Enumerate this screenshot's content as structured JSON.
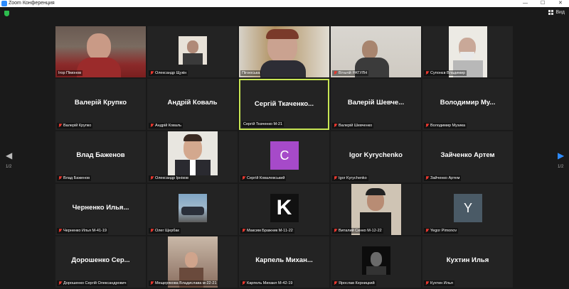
{
  "window": {
    "title": "Zoom Конференция",
    "view_label": "Вид",
    "minimize": "—",
    "maximize": "☐",
    "close": "✕"
  },
  "nav": {
    "left_page": "1/2",
    "right_page": "1/2"
  },
  "tiles": [
    {
      "label": "Ігор Пімонов",
      "display": "",
      "muted": false,
      "kind": "video-man"
    },
    {
      "label": "Олександр Щукін",
      "display": "",
      "muted": true,
      "kind": "photo"
    },
    {
      "label": "Пігоюська",
      "display": "",
      "muted": false,
      "kind": "video-woman"
    },
    {
      "label": "Віталій РАТУЛН",
      "display": "",
      "muted": true,
      "kind": "video-room"
    },
    {
      "label": "Супонєв Владимир",
      "display": "",
      "muted": true,
      "kind": "video-old"
    },
    {
      "label": "Валерій Крупко",
      "display": "Валерій Крупко",
      "muted": true,
      "kind": "name"
    },
    {
      "label": "Андрій Коваль",
      "display": "Андрій Коваль",
      "muted": true,
      "kind": "name"
    },
    {
      "label": "Сергій Ткаченко М-21",
      "display": "Сергій Ткаченко...",
      "muted": false,
      "kind": "name",
      "active": true
    },
    {
      "label": "Валерій Шевченко",
      "display": "Валерій Шевче...",
      "muted": true,
      "kind": "name"
    },
    {
      "label": "Володимир Музика",
      "display": "Володимир Му...",
      "muted": true,
      "kind": "name"
    },
    {
      "label": "Влад Баженов",
      "display": "Влад Баженов",
      "muted": true,
      "kind": "name"
    },
    {
      "label": "Олександр Ірніков",
      "display": "",
      "muted": true,
      "kind": "photo-portrait"
    },
    {
      "label": "Сергій Ковалевський",
      "display": "",
      "muted": true,
      "kind": "avatar-c",
      "avatar": "C"
    },
    {
      "label": "Igor Kyrychenko",
      "display": "Igor Kyrychenko",
      "muted": true,
      "kind": "name"
    },
    {
      "label": "Зайченко Артем",
      "display": "Зайченко Артем",
      "muted": true,
      "kind": "name"
    },
    {
      "label": "Черненко Илья М-41-19",
      "display": "Черненко Илья...",
      "muted": true,
      "kind": "name"
    },
    {
      "label": "Олег Щербак",
      "display": "",
      "muted": true,
      "kind": "photo-car"
    },
    {
      "label": "Максим Бражник М-11-22",
      "display": "",
      "muted": true,
      "kind": "logo-k"
    },
    {
      "label": "Виталий Сенко М-12-22",
      "display": "",
      "muted": true,
      "kind": "photo-selfie"
    },
    {
      "label": "Yegor Pimonov",
      "display": "",
      "muted": true,
      "kind": "avatar-y",
      "avatar": "Y"
    },
    {
      "label": "Дорошенко Сергій Олександрович",
      "display": "Дорошенко Сер...",
      "muted": true,
      "kind": "name"
    },
    {
      "label": "Мещерякова Владислава м-22-21",
      "display": "",
      "muted": true,
      "kind": "photo-room"
    },
    {
      "label": "Карпель Михаил М-42-19",
      "display": "Карпель Михан...",
      "muted": true,
      "kind": "name"
    },
    {
      "label": "Ярослав Керницкий",
      "display": "",
      "muted": true,
      "kind": "photo-dark"
    },
    {
      "label": "Кухтин Илья",
      "display": "Кухтин Илья",
      "muted": true,
      "kind": "name"
    }
  ],
  "colors": {
    "background": "#1a1a1a",
    "tile": "#232323",
    "active_border": "#c8e655",
    "mic_off": "#e8382f",
    "nav_arrow": "#2d8cff"
  }
}
